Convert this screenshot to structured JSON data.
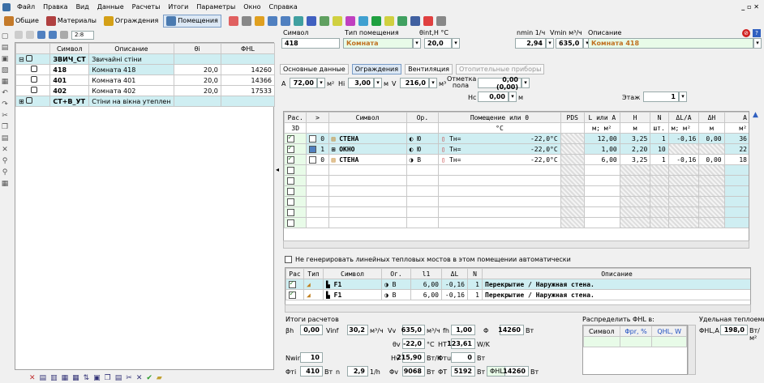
{
  "menu": [
    "Файл",
    "Правка",
    "Вид",
    "Данные",
    "Расчеты",
    "Итоги",
    "Параметры",
    "Окно",
    "Справка"
  ],
  "window_controls": "_ ▫ ✕",
  "tabs": [
    "Общие",
    "Материалы",
    "Ограждения",
    "Помещения"
  ],
  "left": {
    "ratio": "2:8",
    "headers": [
      "Символ",
      "Описание",
      "θi",
      "ΦHL"
    ],
    "rows": [
      {
        "sym": "ЗВИЧ_СТ",
        "desc": "Звичайні стіни",
        "t": "",
        "q": ""
      },
      {
        "sym": "418",
        "desc": "Комната 418",
        "t": "20,0",
        "q": "14260"
      },
      {
        "sym": "401",
        "desc": "Комната 401",
        "t": "20,0",
        "q": "14366"
      },
      {
        "sym": "402",
        "desc": "Комната 402",
        "t": "20,0",
        "q": "17533"
      },
      {
        "sym": "СТ+В_УТ",
        "desc": "Стіни на вікна утеплен",
        "t": "",
        "q": ""
      }
    ]
  },
  "room": {
    "lbl_symbol": "Символ",
    "lbl_type": "Тип помещения",
    "lbl_theta": "θint,H °C",
    "lbl_nmin": "nmin 1/ч",
    "lbl_vmin": "Vmin м³/ч",
    "lbl_desc": "Описание",
    "symbol": "418",
    "type": "Комната",
    "theta": "20,0",
    "nmin": "2,94",
    "vmin": "635,0",
    "desc": "Комната 418"
  },
  "subtabs": [
    "Основные данные",
    "Ограждения",
    "Вентиляция",
    "Отопительные приборы"
  ],
  "params": {
    "a_lbl": "A",
    "a": "72,00",
    "a_unit": "м²",
    "hi_lbl": "Hi",
    "hi": "3,00",
    "hi_unit": "м",
    "v_lbl": "V",
    "v": "216,0",
    "v_unit": "м³",
    "mark_lbl": "Отметка пола",
    "mark": "0,00 (0,00)",
    "hc_lbl": "Hс",
    "hc": "0,00",
    "hc_unit": "м",
    "floor_lbl": "Этаж",
    "floor": "1"
  },
  "main_grid": {
    "headers": [
      "Рас.",
      ">",
      "Символ",
      "Ор.",
      "Помещение или θ",
      "PDS",
      "L или A",
      "H",
      "N",
      "ΔL/A",
      "ΔH",
      "A"
    ],
    "sub": [
      "3D",
      "",
      "",
      "",
      "°C",
      "",
      "м; м²",
      "м",
      "шт.",
      "м; м²",
      "м",
      "м²"
    ],
    "rows": [
      {
        "chk": true,
        "n": "0",
        "sym": "СТЕНА",
        "or": "Ю",
        "room": "Тн=",
        "t": "-22,0°C",
        "l": "12,00",
        "h": "3,25",
        "nn": "1",
        "dl": "-0,16",
        "dh": "0,00",
        "a": "36"
      },
      {
        "chk": true,
        "n": "1",
        "sym": "ОКНО",
        "or": "Ю",
        "room": "Тн=",
        "t": "-22,0°C",
        "l": "1,00",
        "h": "2,20",
        "nn": "10",
        "dl": "",
        "dh": "",
        "a": "22"
      },
      {
        "chk": true,
        "n": "0",
        "sym": "СТЕНА",
        "or": "В",
        "room": "Тн=",
        "t": "-22,0°C",
        "l": "6,00",
        "h": "3,25",
        "nn": "1",
        "dl": "-0,16",
        "dh": "0,00",
        "a": "18"
      }
    ]
  },
  "nogen": "Не генерировать линейных тепловых мостов в этом помещении автоматически",
  "bridges": {
    "headers": [
      "Рас",
      "Тип",
      "Символ",
      "Ог.",
      "l1",
      "ΔL",
      "N",
      "Описание"
    ],
    "rows": [
      {
        "sym": "F1",
        "or": "В",
        "l": "6,00",
        "dl": "-0,16",
        "n": "1",
        "d": "Перекрытие / Наружная стена."
      },
      {
        "sym": "F1",
        "or": "В",
        "l": "6,00",
        "dl": "-0,16",
        "n": "1",
        "d": "Перекрытие / Наружная стена."
      }
    ]
  },
  "results": {
    "title": "Итоги расчетов",
    "bh": "0,00",
    "vinf": "30,2",
    "vv": "635,0",
    "fh": "1,00",
    "phi": "14260",
    "thv": "-22,0",
    "ht": "123,61",
    "nwin": "10",
    "hv": "215,90",
    "phiu": "0",
    "phit": "410",
    "n": "2,9",
    "phiv": "9068",
    "phit2": "5192",
    "phihl": "14260",
    "u_bt": "Вт",
    "u_1h": "1/h",
    "u_m3h": "м³/ч",
    "u_c": "°C",
    "u_wk": "W/K",
    "u_btk": "Вт/К"
  },
  "distrib": {
    "title": "Распределить ΦHL в:",
    "h1": "Символ",
    "h2": "Φpr, %",
    "h3": "QHL, W"
  },
  "specific": {
    "title": "Удельная теплоемкость",
    "lbl": "ΦHL,A",
    "val": "198,0",
    "unit": "Вт/м²"
  }
}
